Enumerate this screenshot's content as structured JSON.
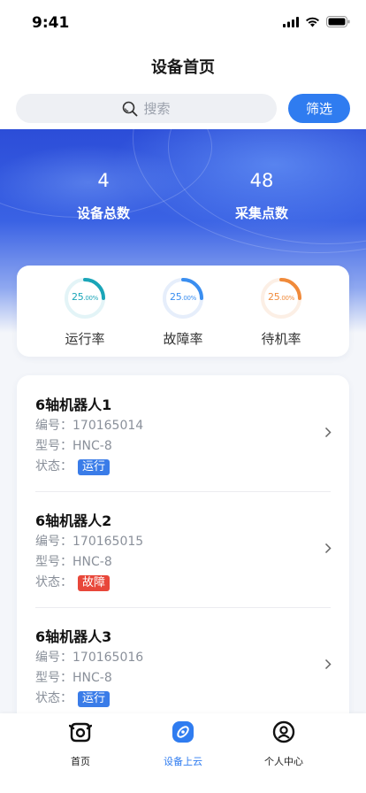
{
  "status_bar": {
    "time": "9:41"
  },
  "header": {
    "title": "设备首页"
  },
  "search": {
    "placeholder": "搜索",
    "filter_label": "筛选"
  },
  "stats": [
    {
      "value": "4",
      "label": "设备总数"
    },
    {
      "value": "48",
      "label": "采集点数"
    }
  ],
  "rates": [
    {
      "value": "25",
      "unit": ".00%",
      "label": "运行率",
      "fraction": 0.25,
      "color": "#1aa5b8",
      "track": "#e3f4f7"
    },
    {
      "value": "25",
      "unit": ".00%",
      "label": "故障率",
      "fraction": 0.25,
      "color": "#3a8ef0",
      "track": "#e6eefb"
    },
    {
      "value": "25",
      "unit": ".00%",
      "label": "待机率",
      "fraction": 0.25,
      "color": "#f08a3a",
      "track": "#fcefe5"
    }
  ],
  "device_labels": {
    "number": "编号：",
    "model": "型号：",
    "status": "状态："
  },
  "devices": [
    {
      "name": "6轴机器人1",
      "number": "170165014",
      "model": "HNC-8",
      "status": "运行",
      "status_color": "#3a7ce8"
    },
    {
      "name": "6轴机器人2",
      "number": "170165015",
      "model": "HNC-8",
      "status": "故障",
      "status_color": "#e8473a"
    },
    {
      "name": "6轴机器人3",
      "number": "170165016",
      "model": "HNC-8",
      "status": "运行",
      "status_color": "#3a7ce8"
    }
  ],
  "tabs": [
    {
      "label": "首页",
      "icon": "home-camera-icon",
      "active": false
    },
    {
      "label": "设备上云",
      "icon": "cloud-device-icon",
      "active": true
    },
    {
      "label": "个人中心",
      "icon": "user-icon",
      "active": false
    }
  ],
  "colors": {
    "accent": "#2f7cf0",
    "banner": "#2c4dd8"
  }
}
